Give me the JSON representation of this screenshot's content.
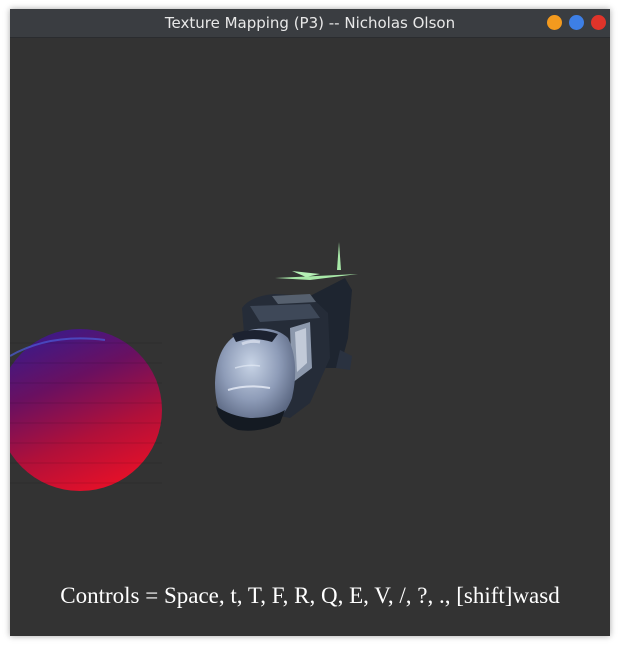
{
  "window": {
    "title": "Texture Mapping (P3) -- Nicholas Olson",
    "controls": {
      "minimize_color": "#f39a1e",
      "maximize_color": "#3d7fe6",
      "close_color": "#e0342a"
    }
  },
  "viewport": {
    "background_color": "#333333",
    "controls_text": "Controls = Space, t, T, F, R, Q, E, V, /, ?, ., [shift]wasd"
  }
}
